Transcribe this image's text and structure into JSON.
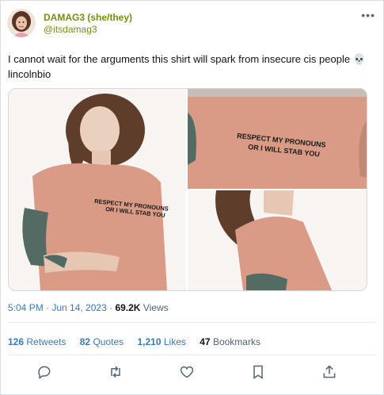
{
  "tweet": {
    "display_name": "DAMAG3 (she/they)",
    "handle": "@itsdamag3",
    "text": "I cannot wait for the arguments this shirt will spark from insecure cis people 💀 lincolnbio",
    "shirt_text_line1": "RESPECT MY PRONOUNS",
    "shirt_text_line2": "OR I WILL STAB YOU",
    "timestamp": "5:04 PM · Jun 14, 2023",
    "views_count": "69.2K",
    "views_label": "Views"
  },
  "stats": {
    "retweets_count": "126",
    "retweets_label": "Retweets",
    "quotes_count": "82",
    "quotes_label": "Quotes",
    "likes_count": "1,210",
    "likes_label": "Likes",
    "bookmarks_count": "47",
    "bookmarks_label": "Bookmarks"
  },
  "icons": {
    "more": "more-icon",
    "reply": "reply-icon",
    "retweet": "retweet-icon",
    "like": "heart-icon",
    "bookmark": "bookmark-icon",
    "share": "share-icon"
  },
  "colors": {
    "name_color": "#7a8a1a",
    "link_color": "#3a7ab8",
    "shirt": "#d99a86"
  }
}
